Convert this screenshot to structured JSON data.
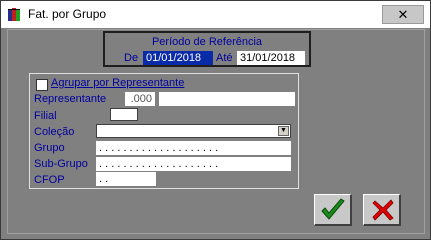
{
  "window": {
    "title": "Fat. por Grupo",
    "close_label": "✕"
  },
  "period": {
    "title": "Período de Referência",
    "from_label": "De",
    "from_value": "01/01/2018",
    "to_label": "Até",
    "to_value": "31/01/2018"
  },
  "filters": {
    "group_by_rep_label": "Agrupar por Representante",
    "group_by_rep_checked": false,
    "representante_label": "Representante",
    "representante_code": ".000",
    "representante_name": "",
    "filial_label": "Filial",
    "filial_value": "",
    "colecao_label": "Coleção",
    "colecao_value": "",
    "grupo_label": "Grupo",
    "grupo_value": ". . . . . . . . . . . . . . . . . . . .",
    "subgrupo_label": "Sub-Grupo",
    "subgrupo_value": ". . . . . . . . . . . . . . . . . . . .",
    "cfop_label": "CFOP",
    "cfop_value": ". ."
  },
  "actions": {
    "confirm_icon": "check-icon",
    "cancel_icon": "cancel-x-icon"
  },
  "colors": {
    "label_blue": "#0000a0",
    "selection": "#0a2ba8",
    "confirm_green": "#1a8a1a",
    "cancel_red": "#e00000"
  }
}
